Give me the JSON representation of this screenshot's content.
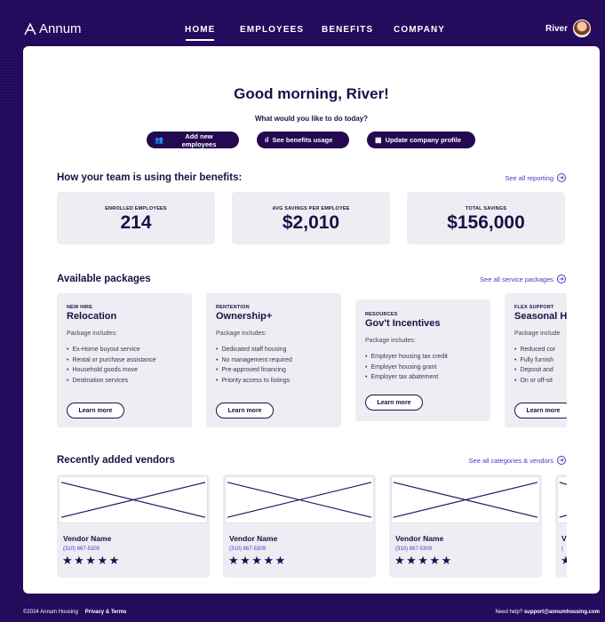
{
  "app": {
    "brand": "Annum",
    "nav": [
      "HOME",
      "EMPLOYEES",
      "BENEFITS",
      "COMPANY"
    ],
    "user_name": "River"
  },
  "hero": {
    "greeting": "Good morning, River!",
    "question": "What would you like to do today?",
    "actions": [
      {
        "label": "Add new employees",
        "icon": "users-icon"
      },
      {
        "label": "See benefits usage",
        "icon": "bar-chart-icon"
      },
      {
        "label": "Update company profile",
        "icon": "building-icon"
      }
    ]
  },
  "benefits": {
    "title": "How your team is using their benefits:",
    "link": "See all reporting",
    "stats": [
      {
        "label": "ENROLLED EMPLOYEES",
        "value": "214"
      },
      {
        "label": "AVG SAVINGS PER EMPLOYEE",
        "value": "$2,010"
      },
      {
        "label": "TOTAL SAVINGS",
        "value": "$156,000"
      }
    ]
  },
  "packages": {
    "title": "Available packages",
    "link": "See all service packages",
    "items": [
      {
        "tag": "NEW HIRE",
        "title": "Relocation",
        "includes": "Package includes:",
        "bullets": [
          "Ex-Home buyout service",
          "Rental or purchase assistance",
          "Household goods move",
          "Destination services"
        ],
        "button": "Learn more"
      },
      {
        "tag": "RENTENTION",
        "title": "Ownership+",
        "includes": "Package includes:",
        "bullets": [
          "Dedicated staff housing",
          "No management required",
          "Pre-approved financing",
          "Priority access to listings"
        ],
        "button": "Learn more"
      },
      {
        "tag": "RESOURCES",
        "title": "Gov't Incentives",
        "includes": "Package includes:",
        "bullets": [
          "Employer housing tax credit",
          "Employer housing grant",
          "Employer tax abatement"
        ],
        "button": "Learn more"
      },
      {
        "tag": "FLEX SUPPORT",
        "title": "Seasonal H",
        "includes": "Package include",
        "bullets": [
          "Reduced cor",
          "Fully furnish",
          "Deposit and",
          "On or off-sit"
        ],
        "button": "Learn more"
      }
    ]
  },
  "vendors": {
    "title": "Recently added vendors",
    "link": "See all categories & vendors",
    "items": [
      {
        "name": "Vendor Name",
        "phone": "(310) 867-5309",
        "stars": "★★★★★"
      },
      {
        "name": "Vendor Name",
        "phone": "(310) 867-5309",
        "stars": "★★★★★"
      },
      {
        "name": "Vendor Name",
        "phone": "(310) 867-5309",
        "stars": "★★★★★"
      },
      {
        "name": "V",
        "phone": "(",
        "stars": "★"
      }
    ]
  },
  "footer": {
    "copyright": "©2024 Annum Housing",
    "privacy": "Privacy & Terms",
    "help_prefix": "Need help?",
    "help_email": "support@annumhousing.com"
  },
  "colors": {
    "background": "#22085a",
    "accent": "#5a2fc4",
    "primary": "#23094f",
    "card": "#eeedf3"
  }
}
